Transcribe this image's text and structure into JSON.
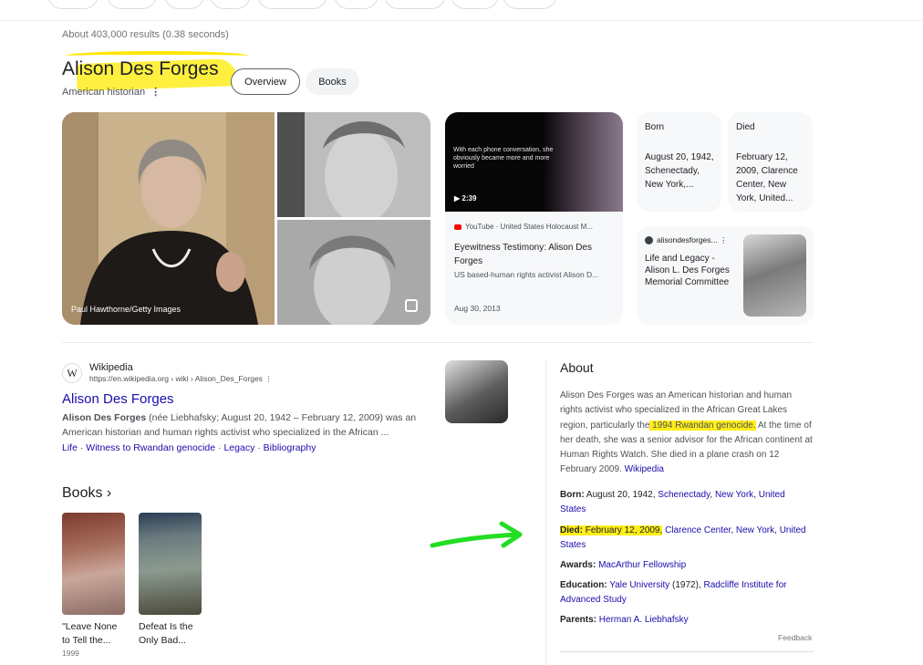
{
  "header": {
    "results_count": "About 403,000 results (0.38 seconds)"
  },
  "entity": {
    "title": "Alison Des Forges",
    "subtitle": "American historian",
    "tabs": [
      {
        "label": "Overview"
      },
      {
        "label": "Books"
      }
    ]
  },
  "images": {
    "main_credit": "Paul Hawthorne/Getty Images"
  },
  "video": {
    "caption": "With each phone conversation, she obviously became more and more worried",
    "duration": "2:39",
    "source": "YouTube · United States Holocaust M...",
    "title": "Eyewitness Testimony: Alison Des Forges",
    "description": "US based-human rights activist Alison D...",
    "date": "Aug 30, 2013"
  },
  "cards": {
    "born": {
      "label": "Born",
      "value": "August 20, 1942, Schenectady, New York,..."
    },
    "died": {
      "label": "Died",
      "value": "February 12, 2009, Clarence Center, New York, United..."
    }
  },
  "legacy": {
    "source": "alisondesforges...",
    "title": "Life and Legacy - Alison L. Des Forges Memorial Committee"
  },
  "wiki": {
    "name": "Wikipedia",
    "url": "https://en.wikipedia.org › wiki › Alison_Des_Forges",
    "title": "Alison Des Forges",
    "snippet_bold": "Alison Des Forges",
    "snippet_rest": " (née Liebhafsky; August 20, 1942 – February 12, 2009) was an American historian and human rights activist who specialized in the African ...",
    "links": [
      "Life",
      "Witness to Rwandan genocide",
      "Legacy",
      "Bibliography"
    ]
  },
  "books": {
    "heading": "Books",
    "items": [
      {
        "title": "\"Leave None to Tell the...",
        "year": "1999"
      },
      {
        "title": "Defeat Is the Only Bad..."
      }
    ]
  },
  "about": {
    "heading": "About",
    "text_1": "Alison Des Forges was an American historian and human rights activist who specialized in the African Great Lakes region, particularly the",
    "text_hl": " 1994 Rwandan genocide.",
    "text_2": " At the time of her death, she was a senior advisor for the African continent at Human Rights Watch. She died in a plane crash on 12 February 2009.",
    "source_link": "Wikipedia",
    "born_label": "Born:",
    "born_text": " August 20, 1942, ",
    "born_links": [
      "Schenectady",
      "New York",
      "United States"
    ],
    "died_label": "Died:",
    "died_text": " February 12, 2009,",
    "died_links": [
      "Clarence Center",
      "New York",
      "United States"
    ],
    "awards_label": "Awards:",
    "awards_link": "MacArthur Fellowship",
    "education_label": "Education:",
    "education_link_1": "Yale University",
    "education_text": " (1972), ",
    "education_link_2": "Radcliffe Institute for Advanced Study",
    "parents_label": "Parents:",
    "parents_link": "Herman A. Liebhafsky",
    "feedback": "Feedback"
  },
  "colors": {
    "link": "#1a0dab",
    "highlight": "#ffeb00",
    "annotation_arrow": "#22dd22"
  }
}
